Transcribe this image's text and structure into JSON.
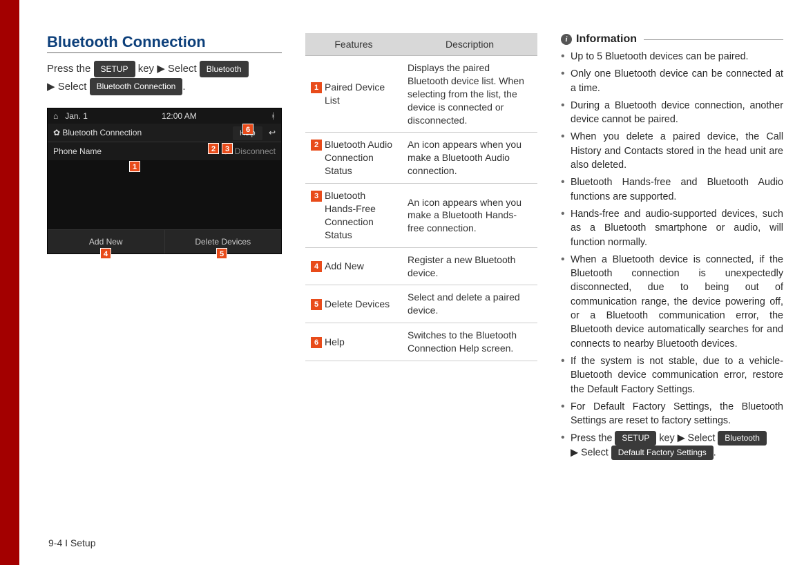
{
  "page_number": "9-4 I Setup",
  "section_title": "Bluetooth Connection",
  "instruction": {
    "press_the": "Press the ",
    "setup_btn": "SETUP",
    "key_select": " key ▶ Select ",
    "bluetooth_btn": "Bluetooth",
    "select": " ▶ Select ",
    "bt_conn_btn": "Bluetooth Connection",
    "period": "."
  },
  "screenshot": {
    "date": "Jan. 1",
    "time": "12:00 AM",
    "title": "Bluetooth Connection",
    "help": "Help",
    "phone_name": "Phone Name",
    "disconnect": "Disconnect",
    "add_new": "Add New",
    "delete_devices": "Delete Devices",
    "callouts": {
      "c1": "1",
      "c2": "2",
      "c3": "3",
      "c4": "4",
      "c5": "5",
      "c6": "6"
    }
  },
  "table": {
    "head_features": "Features",
    "head_description": "Description",
    "rows": [
      {
        "num": "1",
        "feature": "Paired Device List",
        "desc": "Displays the paired Bluetooth device list. When selecting from the list, the device is connected or disconnected."
      },
      {
        "num": "2",
        "feature": "Bluetooth Audio Connection Status",
        "desc": "An icon appears when you make a Bluetooth Audio connection."
      },
      {
        "num": "3",
        "feature": "Bluetooth Hands-Free Connection Status",
        "desc": "An icon appears when you make a Bluetooth Hands-free connection."
      },
      {
        "num": "4",
        "feature": "Add New",
        "desc": "Register a new Bluetooth device."
      },
      {
        "num": "5",
        "feature": "Delete Devices",
        "desc": "Select and delete a paired device."
      },
      {
        "num": "6",
        "feature": "Help",
        "desc": "Switches to the Bluetooth Connection Help screen."
      }
    ]
  },
  "info": {
    "heading": "Information",
    "items": [
      "Up to 5 Bluetooth devices can be paired.",
      "Only one Bluetooth device can be connected at a time.",
      "During a Bluetooth device connection, another device cannot be paired.",
      "When you delete a paired device, the Call History and Contacts stored in the head unit are also deleted.",
      "Bluetooth Hands-free and Bluetooth Audio functions are supported.",
      "Hands-free and audio-supported devices, such as a Bluetooth smartphone or audio, will function normally.",
      "When a Bluetooth device is connected, if the Bluetooth connection is unexpectedly disconnected, due to being out of communication range, the device powering off, or a Bluetooth communication error, the Bluetooth device automatically searches for and connects to nearby Bluetooth devices.",
      "If the system is not stable, due to a vehicle-Bluetooth device communication error, restore the Default Factory Settings.",
      "For Default Factory Settings, the Bluetooth Settings are reset to factory settings."
    ],
    "last_item": {
      "press_the": "Press the ",
      "setup_btn": "SETUP",
      "key_select": " key ▶ Select ",
      "bluetooth_btn": "Bluetooth",
      "select": " ▶ Select ",
      "dfs_btn": "Default Factory Settings",
      "period": "."
    }
  }
}
